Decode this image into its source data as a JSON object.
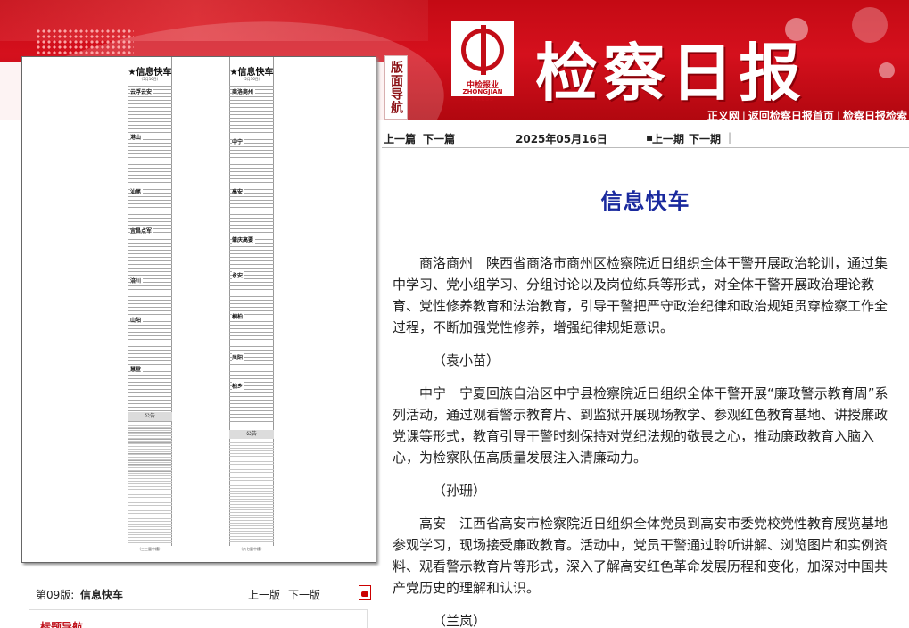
{
  "header": {
    "side_nav_label": "版面导航",
    "logo_cn": "中检报业",
    "logo_en": "ZHONGJIAN PRESS",
    "masthead": "检察日报",
    "links": [
      "正义网",
      "返回检察日报首页",
      "检察日报检索"
    ]
  },
  "thumbnail": {
    "left_column": {
      "heading": "★信息快车",
      "date": "（5月16日）",
      "subheads": [
        "云浮云安",
        "港山",
        "汕尾",
        "宜昌点军",
        "涪川",
        "山阳",
        "慧登"
      ],
      "notice": "公告",
      "footer": "（三三量中槽）"
    },
    "right_column": {
      "heading": "★信息快车",
      "date": "（5月16日）",
      "subheads": [
        "商洛商州",
        "中宁",
        "高安",
        "肇庆高要",
        "永安",
        "桐柏",
        "凤阳",
        "柏乡"
      ],
      "notice": "公告",
      "footer": "（六七量中槽）"
    }
  },
  "edition": {
    "number": "第09版:",
    "title": "信息快车",
    "prev": "上一版",
    "next": "下一版",
    "title_nav_label": "标题导航"
  },
  "nav": {
    "prev_article": "上一篇",
    "next_article": "下一篇",
    "date": "2025年05月16日",
    "prev_issue": "上一期",
    "next_issue": "下一期"
  },
  "article": {
    "title": "信息快车",
    "paragraphs": [
      {
        "type": "para",
        "text": "商洛商州　陕西省商洛市商州区检察院近日组织全体干警开展政治轮训，通过集中学习、党小组学习、分组讨论以及岗位练兵等形式，对全体干警开展政治理论教育、党性修养教育和法治教育，引导干警把严守政治纪律和政治规矩贯穿检察工作全过程，不断加强党性修养，增强纪律规矩意识。"
      },
      {
        "type": "author",
        "text": "（袁小苗）"
      },
      {
        "type": "para",
        "text": "中宁　宁夏回族自治区中宁县检察院近日组织全体干警开展“廉政警示教育周”系列活动，通过观看警示教育片、到监狱开展现场教学、参观红色教育基地、讲授廉政党课等形式，教育引导干警时刻保持对党纪法规的敬畏之心，推动廉政教育入脑入心，为检察队伍高质量发展注入清廉动力。"
      },
      {
        "type": "author",
        "text": "（孙珊）"
      },
      {
        "type": "para",
        "text": "高安　江西省高安市检察院近日组织全体党员到高安市委党校党性教育展览基地参观学习，现场接受廉政教育。活动中，党员干警通过聆听讲解、浏览图片和实例资料、观看警示教育片等形式，深入了解高安红色革命发展历程和变化，加深对中国共产党历史的理解和认识。"
      },
      {
        "type": "author",
        "text": "（兰岚）"
      }
    ]
  },
  "colors": {
    "header_red": "#c40a14",
    "title_blue": "#1a2a9e",
    "nav_label_red": "#c0121c"
  }
}
